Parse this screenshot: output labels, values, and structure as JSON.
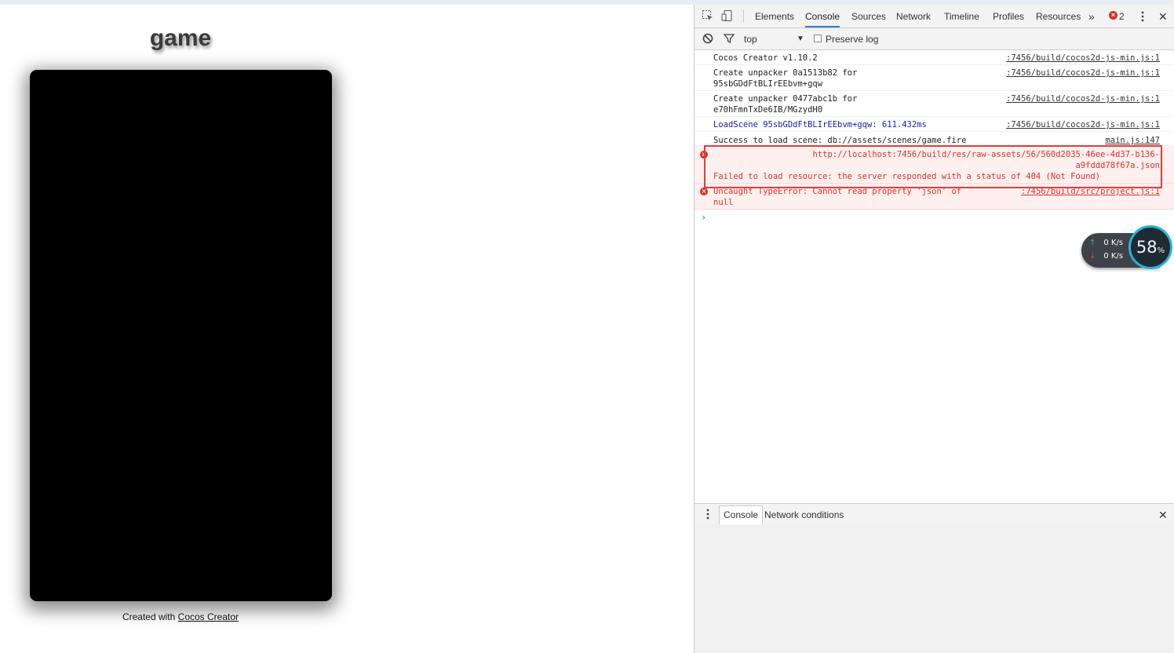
{
  "page": {
    "title": "game",
    "footer_prefix": "Created with ",
    "footer_link": "Cocos Creator"
  },
  "devtools": {
    "tabs": [
      "Elements",
      "Console",
      "Sources",
      "Network",
      "Timeline",
      "Profiles",
      "Resources"
    ],
    "active_tab": "Console",
    "more_tabs": "»",
    "error_count": "2",
    "close": "✕",
    "filter": {
      "context": "top",
      "preserve_log_label": "Preserve log"
    },
    "messages": [
      {
        "text": "Cocos Creator v1.10.2",
        "source": ":7456/build/cocos2d-js-min.js:1"
      },
      {
        "text": "Create unpacker 0a1513b82 for\n95sbGDdFtBLIrEEbvm+gqw",
        "source": ":7456/build/cocos2d-js-min.js:1"
      },
      {
        "text": "Create unpacker 0477abc1b for\ne70hFmnTxDe6IB/MGzydH0",
        "source": ":7456/build/cocos2d-js-min.js:1"
      },
      {
        "text": "LoadScene 95sbGDdFtBLIrEEbvm+gqw: 611.432ms",
        "source": ":7456/build/cocos2d-js-min.js:1"
      },
      {
        "text": "Success to load scene: db://assets/scenes/game.fire",
        "source": "main.js:147"
      },
      {
        "url": "http://localhost:7456/build/res/raw-assets/56/560d2035-46ee-4d37-b136-\na9fddd78f67a.json",
        "text": "Failed to load resource: the server responded with a status of 404 (Not Found)"
      },
      {
        "text": "Uncaught TypeError: Cannot read property 'json' of\nnull",
        "source": ":7456/build/src/project.js:1"
      }
    ],
    "prompt": "›",
    "drawer_tabs": [
      "Console",
      "Network conditions"
    ]
  },
  "speed_widget": {
    "up": "0 K/s",
    "down": "0 K/s",
    "percent": "58",
    "percent_sign": "%",
    "up_arrow": "↑",
    "down_arrow": "↓"
  }
}
